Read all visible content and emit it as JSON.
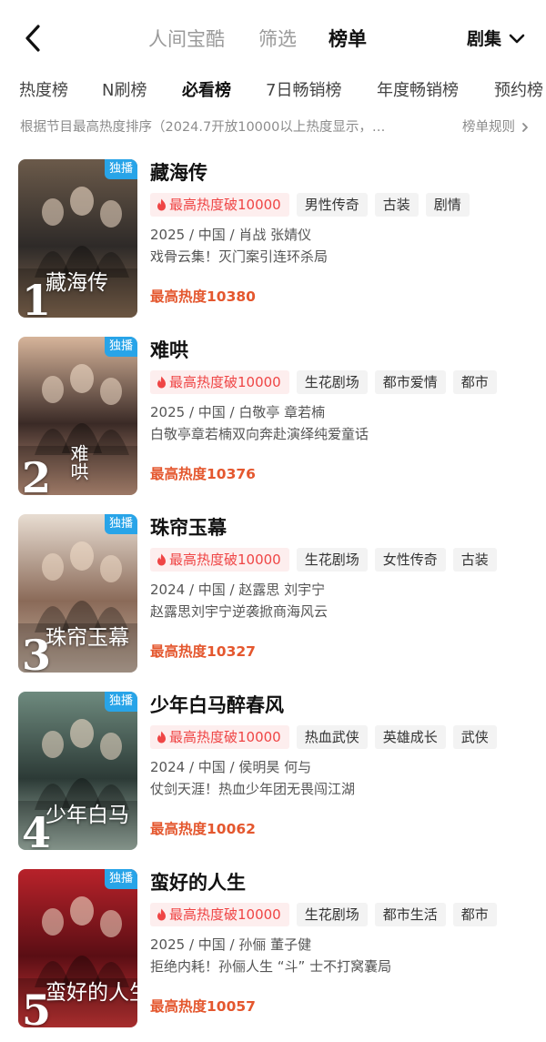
{
  "nav": {
    "tabs": [
      "人间宝酷",
      "筛选",
      "榜单"
    ],
    "genre_label": "剧集"
  },
  "sub_tabs": [
    "热度榜",
    "N刷榜",
    "必看榜",
    "7日畅销榜",
    "年度畅销榜",
    "预约榜"
  ],
  "info": {
    "description": "根据节目最高热度排序（2024.7开放10000以上热度显示，…",
    "rules_label": "榜单规则"
  },
  "badge_label": "独播",
  "items": [
    {
      "rank": "1",
      "poster_title": "藏海传",
      "title": "藏海传",
      "hot_tag": "最高热度破10000",
      "tags": [
        "男性传奇",
        "古装",
        "剧情"
      ],
      "meta": "2025 / 中国 / 肖战 张婧仪",
      "line2": "戏骨云集！灭门案引连环杀局",
      "heat": "最高热度10380",
      "colors": [
        "#6b5a4a",
        "#2e2a28",
        "#8a6e55"
      ]
    },
    {
      "rank": "2",
      "poster_title": "难哄",
      "title": "难哄",
      "hot_tag": "最高热度破10000",
      "tags": [
        "生花剧场",
        "都市爱情",
        "都市"
      ],
      "meta": "2025 / 中国 / 白敬亭 章若楠",
      "line2": "白敬亭章若楠双向奔赴演绎纯爱童话",
      "heat": "最高热度10376",
      "colors": [
        "#d6b49a",
        "#3a2a26",
        "#c89a82"
      ]
    },
    {
      "rank": "3",
      "poster_title": "珠帘玉幕",
      "title": "珠帘玉幕",
      "hot_tag": "最高热度破10000",
      "tags": [
        "生花剧场",
        "女性传奇",
        "古装"
      ],
      "meta": "2024 / 中国 / 赵露思 刘宇宁",
      "line2": "赵露思刘宇宁逆袭掀商海风云",
      "heat": "最高热度10327",
      "colors": [
        "#e8ddd2",
        "#8a6a58",
        "#c8b4a4"
      ]
    },
    {
      "rank": "4",
      "poster_title": "少年白马",
      "title": "少年白马醉春风",
      "hot_tag": "最高热度破10000",
      "tags": [
        "热血武侠",
        "英雄成长",
        "武侠"
      ],
      "meta": "2024 / 中国 / 侯明昊 何与",
      "line2": "仗剑天涯！热血少年团无畏闯江湖",
      "heat": "最高热度10062",
      "colors": [
        "#6e8a7e",
        "#2c3a36",
        "#a8bcb0"
      ]
    },
    {
      "rank": "5",
      "poster_title": "蛮好的人生",
      "title": "蛮好的人生",
      "hot_tag": "最高热度破10000",
      "tags": [
        "生花剧场",
        "都市生活",
        "都市"
      ],
      "meta": "2025 / 中国 / 孙俪 董子健",
      "line2": "拒绝内耗！孙俪人生 “斗” 士不打窝囊局",
      "heat": "最高热度10057",
      "colors": [
        "#b8222a",
        "#5a0e14",
        "#d63a3a"
      ]
    }
  ]
}
